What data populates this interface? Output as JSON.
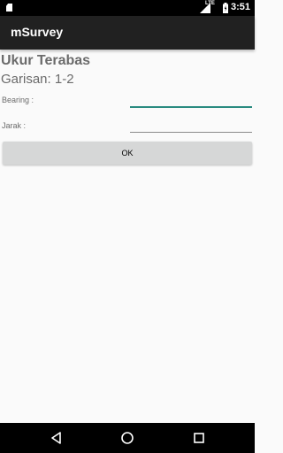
{
  "status_bar": {
    "network_label": "LTE",
    "time": "3:51",
    "icons": [
      "sd-card-icon",
      "signal-icon",
      "battery-icon"
    ]
  },
  "app_bar": {
    "title": "mSurvey"
  },
  "form": {
    "heading": "Ukur Terabas",
    "subheading": "Garisan: 1-2",
    "bearing": {
      "label": "Bearing :",
      "value": "",
      "placeholder": ""
    },
    "jarak": {
      "label": "Jarak :",
      "value": "",
      "placeholder": ""
    },
    "ok_label": "OK"
  },
  "nav_bar": {
    "icons": [
      "back-icon",
      "home-icon",
      "recents-icon"
    ]
  },
  "colors": {
    "accent": "#2a8b80",
    "app_bar": "#212121",
    "text_muted": "#6b6b6b",
    "button": "#d6d7d7"
  }
}
